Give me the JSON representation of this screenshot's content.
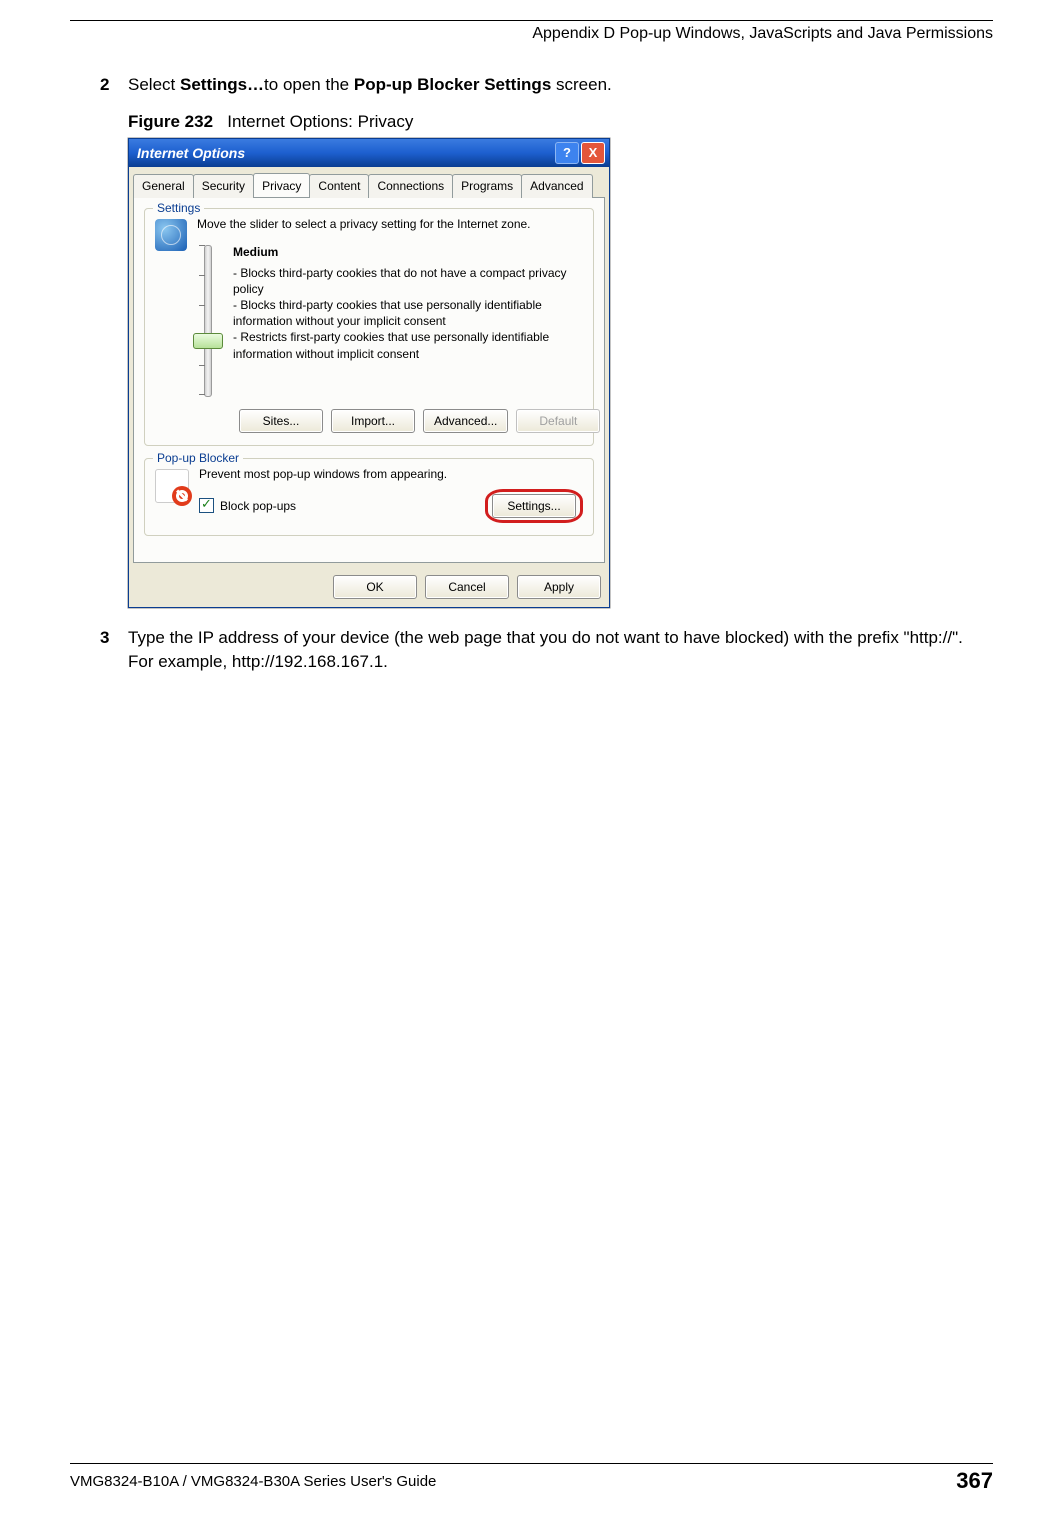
{
  "header": {
    "appendix_title": "Appendix D Pop-up Windows, JavaScripts and Java Permissions"
  },
  "steps": {
    "step2": {
      "num": "2",
      "t1": "Select ",
      "b1": "Settings…",
      "t2": "to open the ",
      "b2": "Pop-up Blocker Settings",
      "t3": " screen."
    },
    "step3": {
      "num": "3",
      "text": "Type the IP address of your device (the web page that you do not want to have blocked) with the prefix \"http://\". For example, http://192.168.167.1."
    }
  },
  "figure": {
    "label": "Figure 232",
    "caption": "Internet Options: Privacy"
  },
  "dialog": {
    "title": "Internet Options",
    "help_glyph": "?",
    "close_glyph": "X",
    "tabs": [
      "General",
      "Security",
      "Privacy",
      "Content",
      "Connections",
      "Programs",
      "Advanced"
    ],
    "active_tab_index": 2,
    "settings": {
      "legend": "Settings",
      "desc": "Move the slider to select a privacy setting for the Internet zone.",
      "level": "Medium",
      "bullets": [
        "- Blocks third-party cookies that do not have a compact privacy policy",
        "- Blocks third-party cookies that use personally identifiable information without your implicit consent",
        "- Restricts first-party cookies that use personally identifiable information without implicit consent"
      ],
      "buttons": {
        "sites": "Sites...",
        "import": "Import...",
        "advanced": "Advanced...",
        "default": "Default"
      }
    },
    "popup": {
      "legend": "Pop-up Blocker",
      "desc": "Prevent most pop-up windows from appearing.",
      "checkbox_label": "Block pop-ups",
      "checkbox_checked": true,
      "settings_btn": "Settings..."
    },
    "bottom": {
      "ok": "OK",
      "cancel": "Cancel",
      "apply": "Apply"
    }
  },
  "footer": {
    "guide": "VMG8324-B10A / VMG8324-B30A Series User's Guide",
    "page": "367"
  }
}
